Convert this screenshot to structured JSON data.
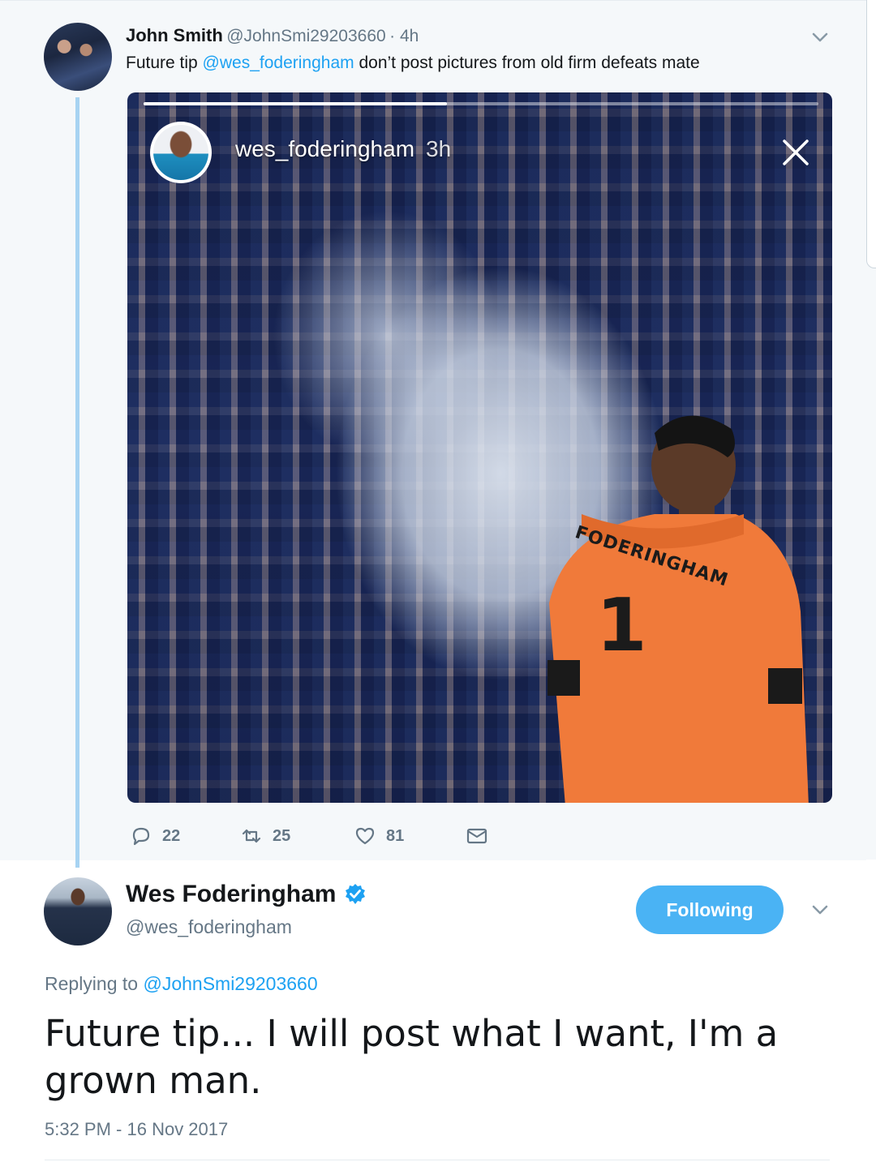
{
  "parent_tweet": {
    "author_name": "John Smith",
    "author_handle": "@JohnSmi29203660",
    "time": "· 4h",
    "text_prefix": "Future tip ",
    "mention": "@wes_foderingham",
    "text_suffix": " don’t post pictures from old firm defeats mate",
    "story": {
      "username": "wes_foderingham",
      "time": "3h",
      "progress": 0.45,
      "jersey_name": "FODERINGHAM",
      "jersey_number": "1"
    },
    "actions": {
      "replies": "22",
      "retweets": "25",
      "likes": "81"
    }
  },
  "main_tweet": {
    "author_name": "Wes Foderingham",
    "author_handle": "@wes_foderingham",
    "follow_label": "Following",
    "replying_prefix": "Replying to ",
    "replying_to": "@JohnSmi29203660",
    "text": "Future tip... I will post what I want, I'm a grown man.",
    "timestamp": "5:32 PM - 16 Nov 2017"
  },
  "colors": {
    "accent": "#1da1f2",
    "button": "#4ab3f4",
    "thread_line": "#a7d3f2",
    "muted": "#657786",
    "jersey": "#f07a3a"
  },
  "icons": [
    "chevron-down-icon",
    "close-icon",
    "reply-icon",
    "retweet-icon",
    "like-icon",
    "direct-message-icon",
    "verified-badge-icon"
  ]
}
